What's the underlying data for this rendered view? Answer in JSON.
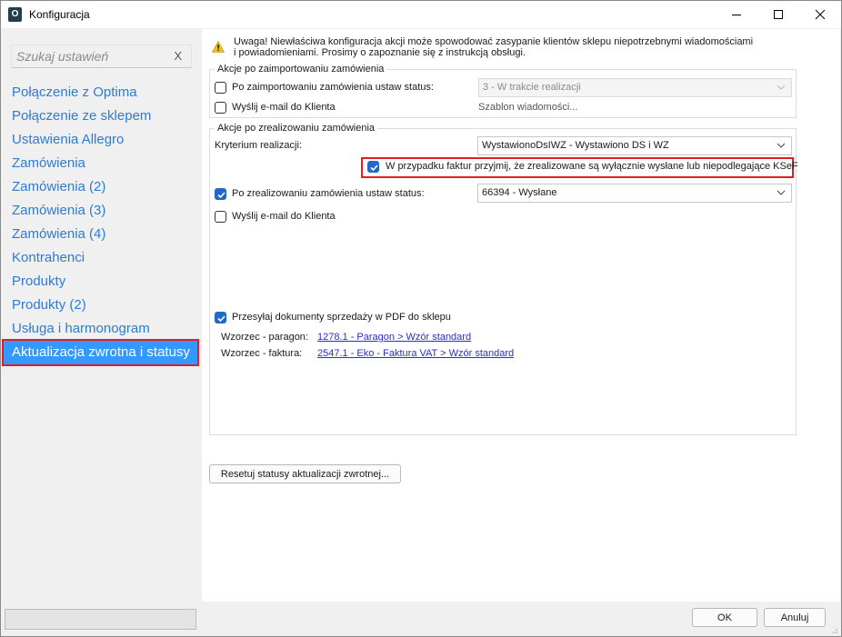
{
  "window": {
    "title": "Konfiguracja",
    "app_icon_letter": "O"
  },
  "sidebar": {
    "search_placeholder": "Szukaj ustawień",
    "search_clear": "X",
    "items": [
      {
        "label": "Połączenie z Optima"
      },
      {
        "label": "Połączenie ze sklepem"
      },
      {
        "label": "Ustawienia Allegro"
      },
      {
        "label": "Zamówienia"
      },
      {
        "label": "Zamówienia (2)"
      },
      {
        "label": "Zamówienia (3)"
      },
      {
        "label": "Zamówienia (4)"
      },
      {
        "label": "Kontrahenci"
      },
      {
        "label": "Produkty"
      },
      {
        "label": "Produkty (2)"
      },
      {
        "label": "Usługa i harmonogram"
      },
      {
        "label": "Aktualizacja zwrotna i statusy",
        "selected": true
      }
    ]
  },
  "main": {
    "warning_line1": "Uwaga! Niewłaściwa konfiguracja akcji może spowodować zasypanie klientów sklepu niepotrzebnymi wiadomościami",
    "warning_line2": "i powiadomieniami. Prosimy o zapoznanie się z instrukcją obsługi.",
    "import_group": {
      "legend": "Akcje po zaimportowaniu zamówienia",
      "set_status_label": "Po zaimportowaniu zamówienia ustaw status:",
      "set_status_checked": false,
      "status_value": "3 - W trakcie realizacji",
      "send_email_label": "Wyślij e-mail do Klienta",
      "send_email_checked": false,
      "template_label": "Szablon wiadomości..."
    },
    "realize_group": {
      "legend": "Akcje po zrealizowaniu zamówienia",
      "criterion_label": "Kryterium realizacji:",
      "criterion_value": "WystawionoDsIWZ - Wystawiono DS i WZ",
      "ksef_label": "W przypadku faktur przyjmij, że zrealizowane są wyłącznie wysłane lub niepodlegające KSeF",
      "ksef_checked": true,
      "set_status_label": "Po zrealizowaniu zamówienia ustaw status:",
      "set_status_checked": true,
      "status_value": "66394 - Wysłane",
      "send_email_label": "Wyślij e-mail do Klienta",
      "send_email_checked": false,
      "pdf_label": "Przesyłaj dokumenty sprzedaży w PDF do sklepu",
      "pdf_checked": true,
      "receipt_label": "Wzorzec - paragon:",
      "receipt_link": "1278.1 - Paragon > Wzór standard",
      "invoice_label": "Wzorzec - faktura:",
      "invoice_link": "2547.1 - Eko - Faktura VAT > Wzór standard"
    },
    "reset_button": "Resetuj statusy aktualizacji zwrotnej..."
  },
  "footer": {
    "ok_button": "OK",
    "cancel_button": "Anuluj"
  },
  "colors": {
    "accent": "#3399ff",
    "link": "#2e7bd6",
    "highlight": "#e51c23",
    "checkbox": "#2268c9"
  }
}
